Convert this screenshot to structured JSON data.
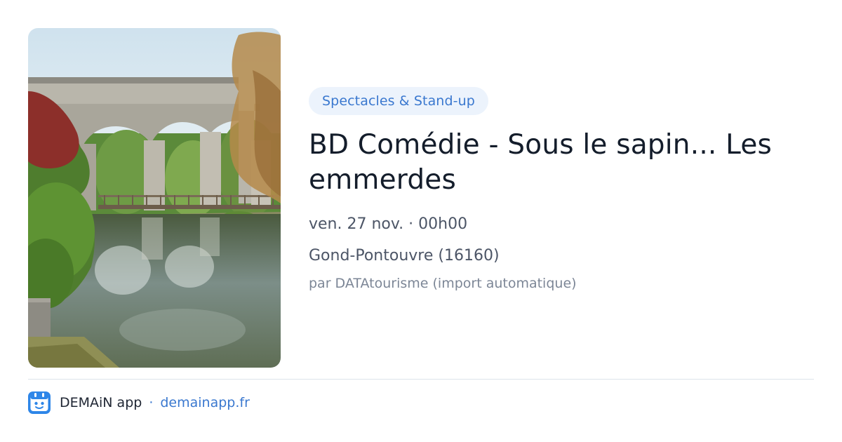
{
  "event": {
    "category": "Spectacles & Stand-up",
    "title": "BD Comédie - Sous le sapin... Les emmerdes",
    "datetime": "ven. 27 nov. · 00h00",
    "location": "Gond-Pontouvre (16160)",
    "source": "par DATAtourisme (import automatique)",
    "image": "photo of a stone arched railway viaduct over a river with a footbridge and trees"
  },
  "footer": {
    "app_name": "DEMAiN app",
    "separator": "·",
    "site": "demainapp.fr",
    "logo_icon": "demain-app-logo-icon"
  },
  "colors": {
    "accent": "#3a78cf",
    "tag_background": "#ecf3fc",
    "title": "#141d2b",
    "meta": "#4c5566",
    "muted": "#7c8696",
    "divider": "#dde3ea",
    "logo": "#2e86e8"
  }
}
